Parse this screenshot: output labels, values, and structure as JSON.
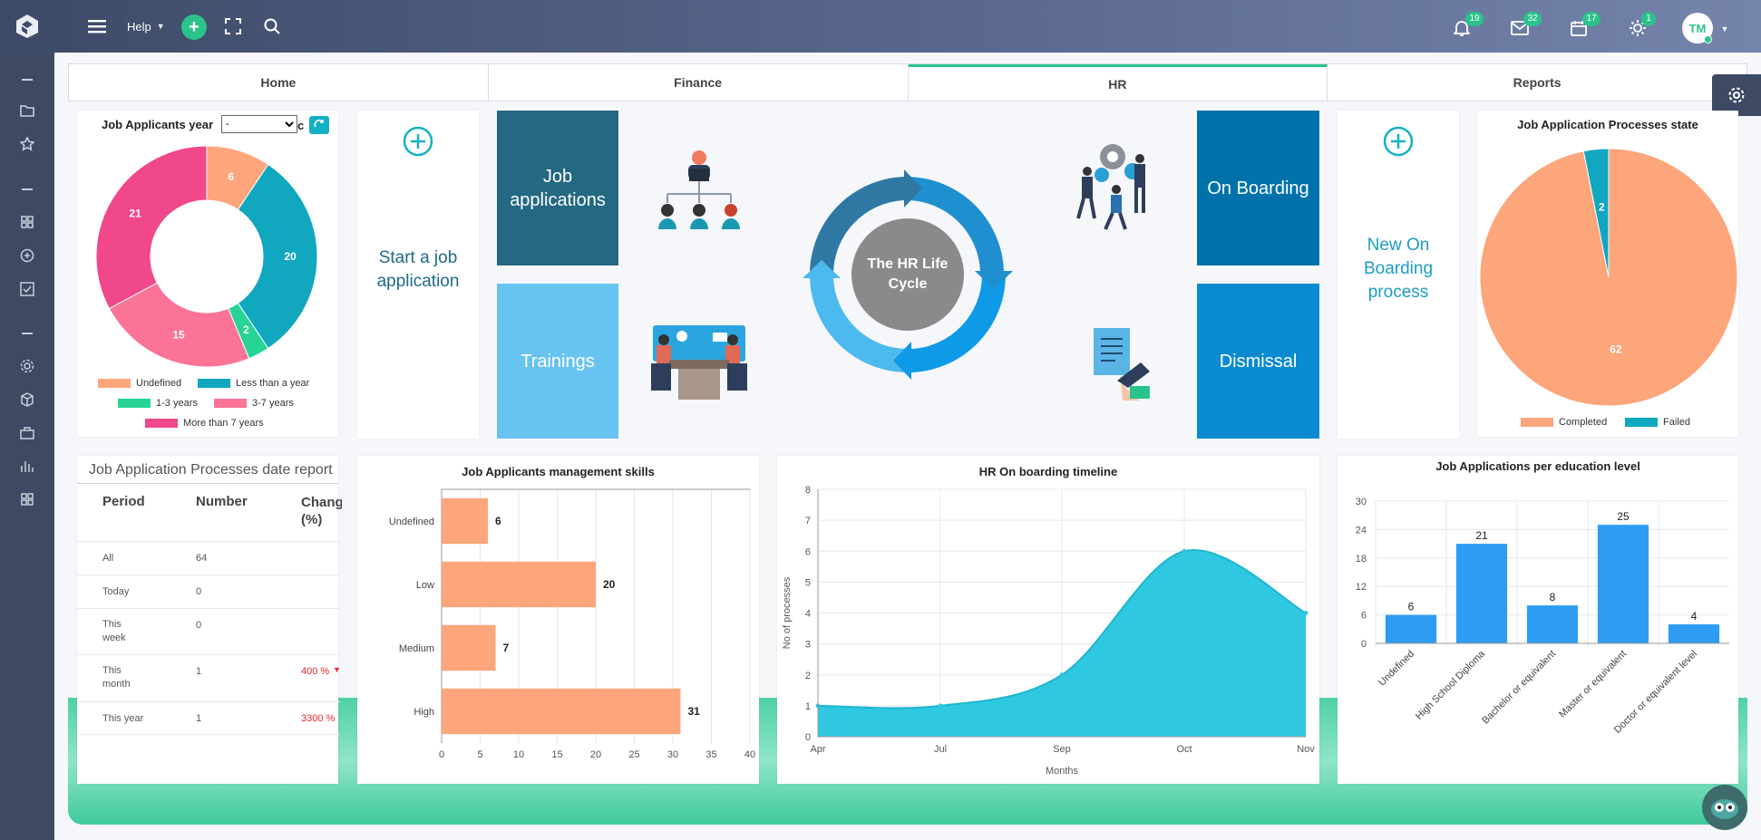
{
  "topbar": {
    "help_label": "Help",
    "notifications_count": "19",
    "messages_count": "32",
    "calendar_count": "17",
    "tasks_count": "1",
    "avatar_initials": "TM"
  },
  "tabs": [
    "Home",
    "Finance",
    "HR",
    "Reports"
  ],
  "applicants_years": {
    "title_left": "Job Applicants year",
    "title_right": "c",
    "select_value": "-",
    "legend": [
      "Undefined",
      "Less than a year",
      "1-3 years",
      "3-7 years",
      "More than 7 years"
    ]
  },
  "tiles": {
    "start_job_application": "Start a job application",
    "job_applications": "Job applications",
    "trainings": "Trainings",
    "hr_life_cycle": "The HR Life Cycle",
    "on_boarding": "On Boarding",
    "dismissal": "Dismissal",
    "new_on_boarding": "New On Boarding process"
  },
  "process_state": {
    "title": "Job Application Processes state",
    "legend": [
      "Completed",
      "Failed"
    ]
  },
  "date_report": {
    "title": "Job Application Processes date report",
    "headers": [
      "Period",
      "Number",
      "Chang (%)"
    ],
    "rows": [
      {
        "period": "All",
        "number": "64",
        "change": ""
      },
      {
        "period": "Today",
        "number": "0",
        "change": ""
      },
      {
        "period": "This week",
        "number": "0",
        "change": ""
      },
      {
        "period": "This month",
        "number": "1",
        "change": "400 %"
      },
      {
        "period": "This year",
        "number": "1",
        "change": "3300 %"
      }
    ]
  },
  "colors": {
    "accent": "#2bc28c",
    "salmon": "#fda57b",
    "teal": "#10a7bf",
    "pink": "#f0488a",
    "rose": "#fb7397",
    "green": "#27d496",
    "blue_bar": "#2e9cf3",
    "area": "#2ec8e0",
    "negative": "#e8262a"
  },
  "chart_data": [
    {
      "type": "pie",
      "title": "Job Applicants year",
      "categories": [
        "Undefined",
        "Less than a year",
        "1-3 years",
        "3-7 years",
        "More than 7 years"
      ],
      "values": [
        6,
        20,
        2,
        15,
        21
      ],
      "colors": [
        "#fda57b",
        "#10a7bf",
        "#27d496",
        "#fb7397",
        "#f0488a"
      ],
      "legend": "bottom"
    },
    {
      "type": "pie",
      "title": "Job Application Processes state",
      "categories": [
        "Completed",
        "Failed"
      ],
      "values": [
        62,
        2
      ],
      "colors": [
        "#fda57b",
        "#10a7bf"
      ],
      "legend": "bottom"
    },
    {
      "type": "bar",
      "orientation": "horizontal",
      "title": "Job Applicants management skills",
      "categories": [
        "Undefined",
        "Low",
        "Medium",
        "High"
      ],
      "values": [
        6,
        20,
        7,
        31
      ],
      "xlim": [
        0,
        40
      ],
      "xticks": [
        0,
        5,
        10,
        15,
        20,
        25,
        30,
        35,
        40
      ],
      "grid": true
    },
    {
      "type": "area",
      "title": "HR On boarding timeline",
      "x": [
        "Apr",
        "Jul",
        "Sep",
        "Oct",
        "Nov"
      ],
      "values": [
        1,
        1,
        2,
        6,
        4
      ],
      "xlabel": "Months",
      "ylabel": "No of processes",
      "ylim": [
        0,
        8
      ],
      "yticks": [
        0,
        1,
        2,
        3,
        4,
        5,
        6,
        7,
        8
      ],
      "grid": true
    },
    {
      "type": "bar",
      "title": "Job Applications per education level",
      "categories": [
        "Undefined",
        "High School Diploma",
        "Bachelor or equivalent",
        "Master or equivalent",
        "Doctor or equivalent level"
      ],
      "values": [
        6,
        21,
        8,
        25,
        4
      ],
      "ylim": [
        0,
        30
      ],
      "yticks": [
        0,
        6,
        12,
        18,
        24,
        30
      ],
      "grid": true
    }
  ]
}
